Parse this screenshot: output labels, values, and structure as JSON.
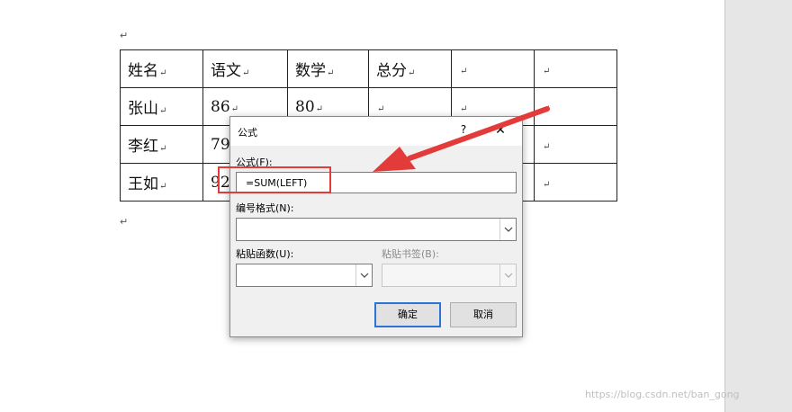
{
  "document": {
    "paragraph_mark": "↵",
    "table": {
      "rows": [
        [
          "姓名",
          "语文",
          "数学",
          "总分",
          "",
          ""
        ],
        [
          "张山",
          "86",
          "80",
          "",
          "",
          ""
        ],
        [
          "李红",
          "79",
          "",
          "",
          "",
          ""
        ],
        [
          "王如",
          "92",
          "",
          "",
          "",
          ""
        ]
      ],
      "cell_mark": "↵"
    }
  },
  "dialog": {
    "title": "公式",
    "help": "?",
    "close": "✕",
    "formula_label": "公式(F):",
    "formula_value": "=SUM(LEFT)",
    "number_format_label": "编号格式(N):",
    "number_format_value": "",
    "paste_function_label": "粘贴函数(U):",
    "paste_function_value": "",
    "paste_bookmark_label": "粘贴书签(B):",
    "paste_bookmark_value": "",
    "ok": "确定",
    "cancel": "取消"
  },
  "annotation": {
    "color": "#e33a3a"
  },
  "watermark": "https://blog.csdn.net/ban_gong"
}
